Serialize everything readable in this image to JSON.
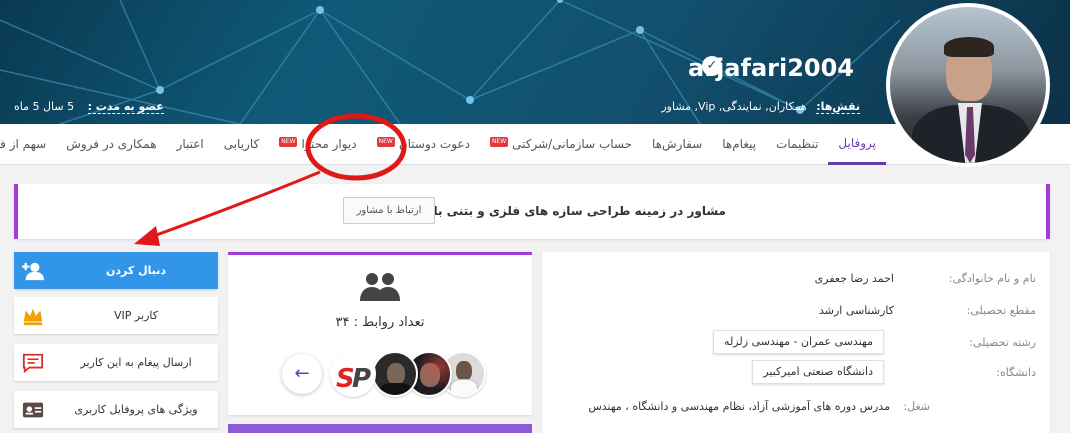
{
  "header": {
    "username": "arjafari2004",
    "roles_label": "نقش‌ها:",
    "roles_value": "همکاران, نمایندگی, Vip, مشاور",
    "membership_label": "عضو به مدت :",
    "membership_value": "5 سال 5 ماه"
  },
  "tabs": [
    {
      "label": "پروفایل",
      "active": true,
      "new": false
    },
    {
      "label": "تنظیمات",
      "active": false,
      "new": false
    },
    {
      "label": "پیغام‌ها",
      "active": false,
      "new": false
    },
    {
      "label": "سفارش‌ها",
      "active": false,
      "new": false
    },
    {
      "label": "حساب سازمانی/شرکتی",
      "active": false,
      "new": true
    },
    {
      "label": "دعوت دوستان",
      "active": false,
      "new": true
    },
    {
      "label": "دیوار محتوا",
      "active": false,
      "new": true
    },
    {
      "label": "کاریابی",
      "active": false,
      "new": false
    },
    {
      "label": "اعتبار",
      "active": false,
      "new": false
    },
    {
      "label": "همکاری در فروش",
      "active": false,
      "new": false
    },
    {
      "label": "سهم از فروش",
      "active": false,
      "new": false
    }
  ],
  "new_badge": "NEW",
  "bio": {
    "text": "مشاور در زمینه طراحی سازه های فلزی و بتنی با نرم افزار",
    "contact_button": "ارتباط با مشاور"
  },
  "profile_info": {
    "name_label": "نام و نام خانوادگی:",
    "name_value": "احمد رضا جعفری",
    "degree_label": "مقطع تحصیلی:",
    "degree_value": "کارشناسی ارشد",
    "field_label": "رشته تحصیلی:",
    "field_value": "مهندسی عمران - مهندسی زلزله",
    "university_label": "دانشگاه:",
    "university_value": "دانشگاه صنعتی امیرکبیر",
    "job_label": "شغل:",
    "job_value": "مدرس دوره های آموزشی آزاد، نظام مهندسی و دانشگاه ، مهندس"
  },
  "connections": {
    "count_text": "تعداد روابط : ۳۴",
    "prev_arrow": "←"
  },
  "actions": {
    "follow": "دنبال کردن",
    "vip": "کاربر VIP",
    "message": "ارسال پیغام به این کاربر",
    "features": "ویژگی های پروفایل کاربری"
  },
  "colors": {
    "accent_purple": "#6a3ab0",
    "follow_blue": "#3196e8",
    "bio_border": "#a53bd8",
    "annotation_red": "#e01818"
  }
}
